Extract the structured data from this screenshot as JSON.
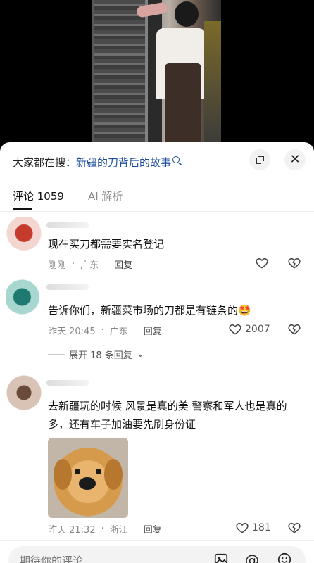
{
  "search": {
    "prefix": "大家都在搜：",
    "query": "新疆的刀背后的故事"
  },
  "tabs": [
    {
      "label": "评论 1059",
      "active": true
    },
    {
      "label": "AI 解析",
      "active": false
    }
  ],
  "comments": [
    {
      "text": "现在买刀都需要实名登记",
      "time": "刚刚",
      "location": "广东",
      "reply_label": "回复",
      "likes": ""
    },
    {
      "text": "告诉你们，新疆菜市场的刀都是有链条的🤩",
      "time": "昨天 20:45",
      "location": "广东",
      "reply_label": "回复",
      "likes": "2007",
      "expand_replies": "展开 18 条回复"
    },
    {
      "text": "去新疆玩的时候 风景是真的美 警察和军人也是真的多，还有车子加油要先刷身份证",
      "time": "昨天 21:32",
      "location": "浙江",
      "reply_label": "回复",
      "likes": "181"
    }
  ],
  "input": {
    "placeholder": "期待你的评论"
  },
  "icons": {
    "expand": "expand-icon",
    "close": "close-icon",
    "like": "heart-icon",
    "dislike": "broken-heart-icon",
    "image": "image-icon",
    "mention": "at-icon",
    "emoji": "emoji-icon"
  },
  "colors": {
    "accent": "#1f4f9c",
    "text": "#111111",
    "meta": "#888888"
  }
}
